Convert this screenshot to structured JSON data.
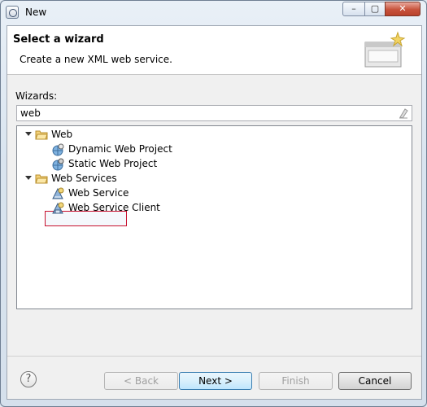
{
  "window": {
    "title": "New",
    "minimize": "–",
    "maximize": "▢",
    "close": "✕"
  },
  "banner": {
    "title": "Select a wizard",
    "description": "Create a new XML web service."
  },
  "wizards": {
    "label": "Wizards:",
    "filter_value": "web"
  },
  "tree": {
    "web": {
      "label": "Web",
      "children": [
        "Dynamic Web Project",
        "Static Web Project"
      ]
    },
    "web_services": {
      "label": "Web Services",
      "children": [
        "Web Service",
        "Web Service Client"
      ]
    }
  },
  "buttons": {
    "help": "?",
    "back": "< Back",
    "next": "Next >",
    "finish": "Finish",
    "cancel": "Cancel"
  }
}
